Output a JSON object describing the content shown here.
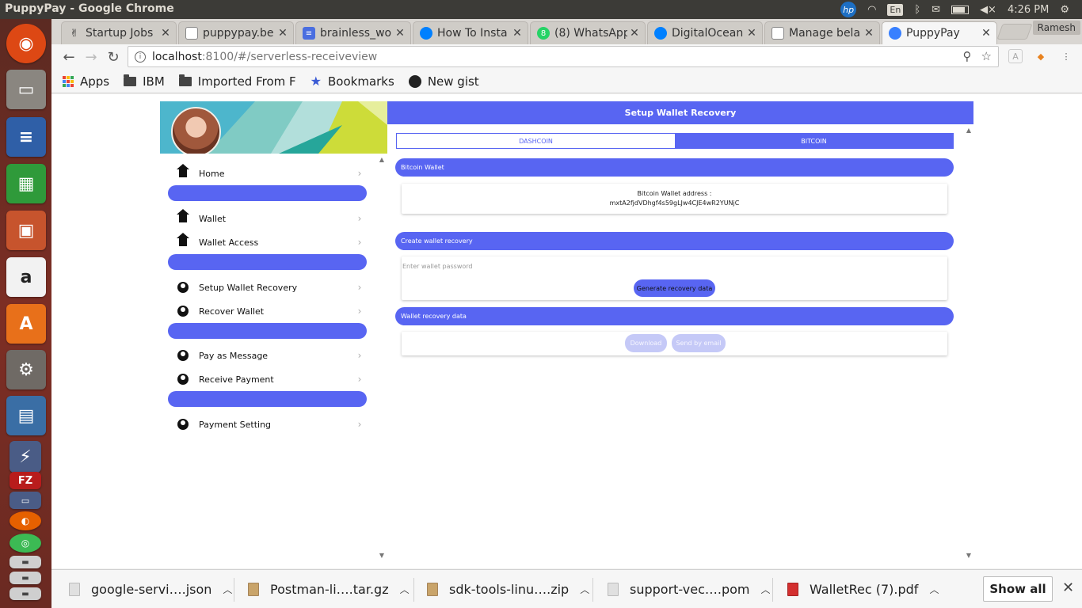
{
  "window": {
    "title": "PuppyPay - Google Chrome"
  },
  "tray": {
    "lang": "En",
    "time": "4:26 PM",
    "hp": "hp"
  },
  "tabs": [
    {
      "label": "Startup Jobs",
      "icon": "peace-icon"
    },
    {
      "label": "puppypay.be",
      "icon": "page-icon"
    },
    {
      "label": "brainless_wo",
      "icon": "docs-icon"
    },
    {
      "label": "How To Insta",
      "icon": "digitalocean-icon"
    },
    {
      "label": "(8) WhatsApp",
      "icon": "whatsapp-icon",
      "badge": "8"
    },
    {
      "label": "DigitalOcean",
      "icon": "digitalocean-icon"
    },
    {
      "label": "Manage bela",
      "icon": "page-icon"
    },
    {
      "label": "PuppyPay",
      "icon": "ionic-icon",
      "active": true
    }
  ],
  "profile": "Ramesh",
  "address": {
    "host": "localhost",
    "path": ":8100/#/serverless-receiveview"
  },
  "bookmarks": [
    {
      "label": "Apps"
    },
    {
      "label": "IBM"
    },
    {
      "label": "Imported From F"
    },
    {
      "label": "Bookmarks"
    },
    {
      "label": "New gist"
    }
  ],
  "sidebar": {
    "items": [
      {
        "label": "Home",
        "icon": "home-icon"
      },
      {
        "label": "Wallet",
        "icon": "home-icon"
      },
      {
        "label": "Wallet Access",
        "icon": "home-icon"
      },
      {
        "label": "Setup Wallet Recovery",
        "icon": "person-icon"
      },
      {
        "label": "Recover Wallet",
        "icon": "person-icon"
      },
      {
        "label": "Pay as Message",
        "icon": "person-icon"
      },
      {
        "label": "Receive Payment",
        "icon": "person-icon"
      },
      {
        "label": "Payment Setting",
        "icon": "person-icon"
      }
    ]
  },
  "main": {
    "title": "Setup Wallet Recovery",
    "segments": [
      "DASHCOIN",
      "BITCOIN"
    ],
    "bitcoin_wallet": {
      "header": "Bitcoin Wallet",
      "address_label": "Bitcoin Wallet address :",
      "address": "mxtA2fjdVDhgf4s59gLJw4CJE4wR2YUNjC"
    },
    "recovery": {
      "header": "Create wallet recovery",
      "password_placeholder": "Enter wallet password",
      "generate_label": "Generate recovery data"
    },
    "recovery_data": {
      "header": "Wallet recovery data",
      "download_label": "Download",
      "email_label": "Send by email"
    }
  },
  "colors": {
    "accent": "#5865f2",
    "accent_disabled": "#c5c9f7"
  },
  "downloads": [
    {
      "name": "google-servi….json"
    },
    {
      "name": "Postman-li….tar.gz"
    },
    {
      "name": "sdk-tools-linu….zip"
    },
    {
      "name": "support-vec….pom"
    },
    {
      "name": "WalletRec (7).pdf"
    }
  ],
  "shelf": {
    "show_all": "Show all"
  }
}
